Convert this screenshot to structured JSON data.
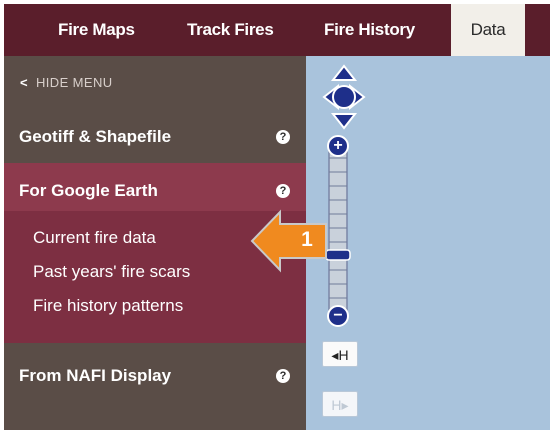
{
  "nav": {
    "tabs": [
      {
        "label": "Fire Maps"
      },
      {
        "label": "Track Fires"
      },
      {
        "label": "Fire History"
      },
      {
        "label": "Data"
      }
    ],
    "active_tab": "Data"
  },
  "sidebar": {
    "hide_menu": "HIDE MENU",
    "sections": [
      {
        "title": "Geotiff & Shapefile"
      },
      {
        "title": "For Google Earth",
        "links": [
          "Current fire data",
          "Past years' fire scars",
          "Fire history patterns"
        ]
      },
      {
        "title": "From NAFI Display"
      }
    ],
    "help_glyph": "?"
  },
  "map_controls": {
    "zoom_in": "+",
    "zoom_out": "−",
    "history_back": "◂H",
    "history_forward": "H▸"
  },
  "callout": {
    "number": "1"
  },
  "colors": {
    "topbar": "#5a1e2b",
    "sidebar": "#5a4d47",
    "highlight": "#7d2f42",
    "map": "#a9c3dc",
    "callout_arrow": "#f08a1f",
    "control_blue": "#1e2f8a"
  }
}
